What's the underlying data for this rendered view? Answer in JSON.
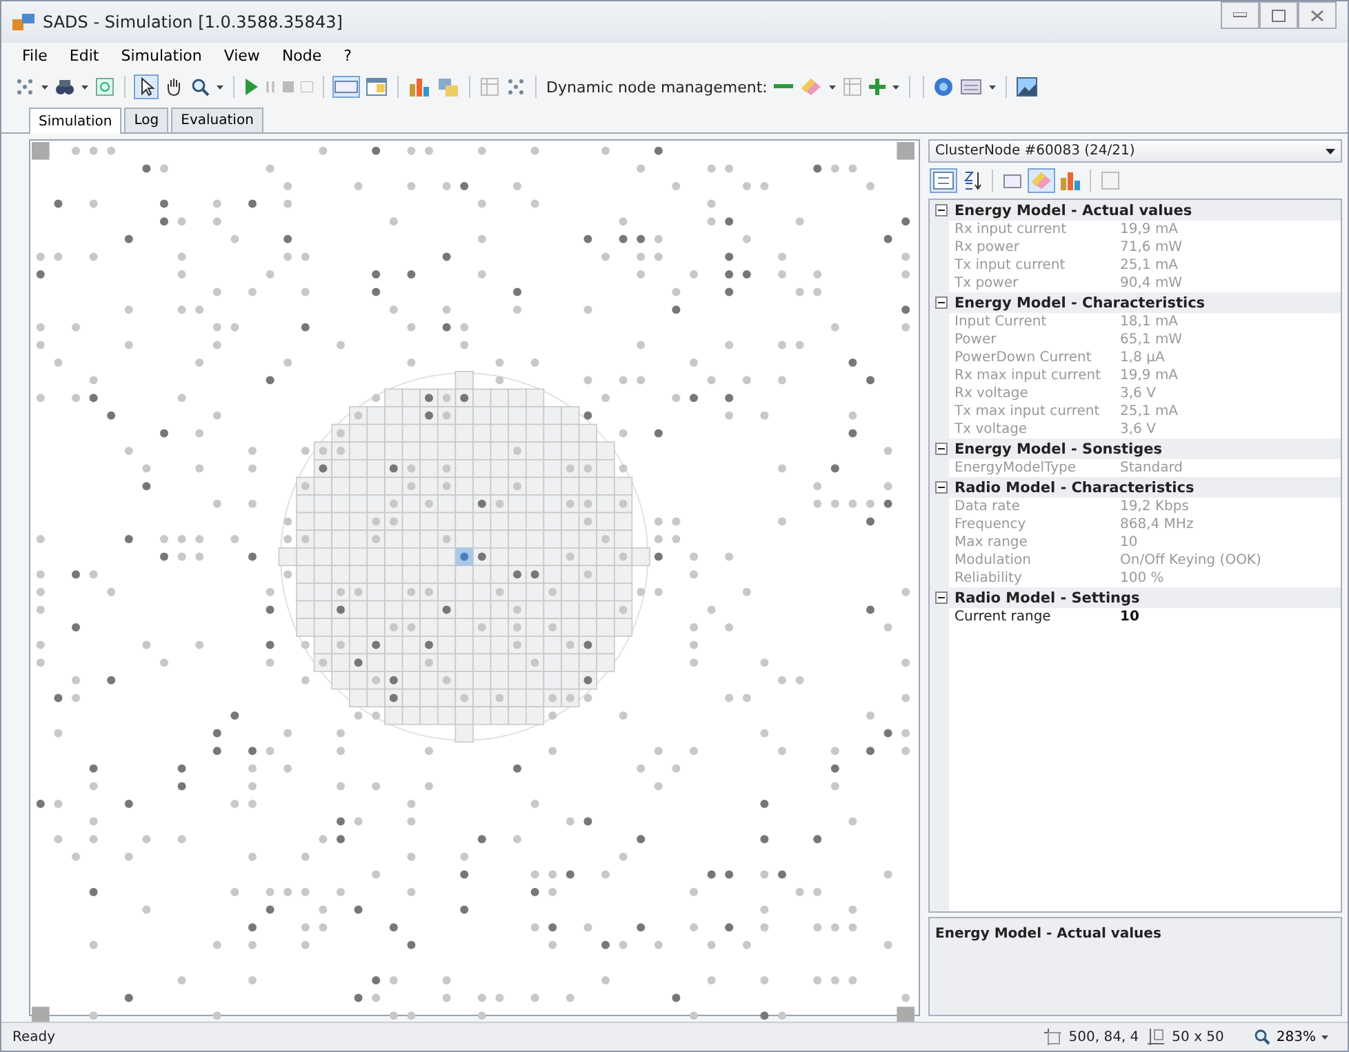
{
  "window": {
    "title": "SADS - Simulation [1.0.3588.35843]"
  },
  "menu": [
    "File",
    "Edit",
    "Simulation",
    "View",
    "Node",
    "?"
  ],
  "toolbar": {
    "label": "Dynamic node management:"
  },
  "tabs": [
    {
      "label": "Simulation",
      "selected": true
    },
    {
      "label": "Log",
      "selected": false
    },
    {
      "label": "Evaluation",
      "selected": false
    }
  ],
  "node_selector": {
    "value": "ClusterNode #60083 (24/21)"
  },
  "properties": [
    {
      "category": "Energy Model - Actual values",
      "expanded": true,
      "rows": [
        {
          "name": "Rx input current",
          "value": "19,9 mA",
          "readonly": true
        },
        {
          "name": "Rx power",
          "value": "71,6 mW",
          "readonly": true
        },
        {
          "name": "Tx input current",
          "value": "25,1 mA",
          "readonly": true
        },
        {
          "name": "Tx power",
          "value": "90,4 mW",
          "readonly": true
        }
      ]
    },
    {
      "category": "Energy Model - Characteristics",
      "expanded": true,
      "rows": [
        {
          "name": "Input Current",
          "value": "18,1 mA",
          "readonly": true
        },
        {
          "name": "Power",
          "value": "65,1 mW",
          "readonly": true
        },
        {
          "name": "PowerDown Current",
          "value": "1,8 µA",
          "readonly": true
        },
        {
          "name": "Rx max input current",
          "value": "19,9 mA",
          "readonly": true
        },
        {
          "name": "Rx voltage",
          "value": "3,6 V",
          "readonly": true
        },
        {
          "name": "Tx max input current",
          "value": "25,1 mA",
          "readonly": true
        },
        {
          "name": "Tx voltage",
          "value": "3,6 V",
          "readonly": true
        }
      ]
    },
    {
      "category": "Energy Model - Sonstiges",
      "expanded": true,
      "rows": [
        {
          "name": "EnergyModelType",
          "value": "Standard",
          "readonly": true
        }
      ]
    },
    {
      "category": "Radio Model - Characteristics",
      "expanded": true,
      "rows": [
        {
          "name": "Data rate",
          "value": "19,2 Kbps",
          "readonly": true
        },
        {
          "name": "Frequency",
          "value": "868,4 MHz",
          "readonly": true
        },
        {
          "name": "Max range",
          "value": "10",
          "readonly": true
        },
        {
          "name": "Modulation",
          "value": "On/Off Keying (OOK)",
          "readonly": true
        },
        {
          "name": "Reliability",
          "value": "100 %",
          "readonly": true
        }
      ]
    },
    {
      "category": "Radio Model - Settings",
      "expanded": true,
      "rows": [
        {
          "name": "Current range",
          "value": "10",
          "readonly": false
        }
      ]
    }
  ],
  "description": {
    "title": "Energy Model - Actual values"
  },
  "status_bar": {
    "text": "Ready",
    "position": "500, 84, 4",
    "grid_size": "50 x 50",
    "zoom": "283%"
  }
}
